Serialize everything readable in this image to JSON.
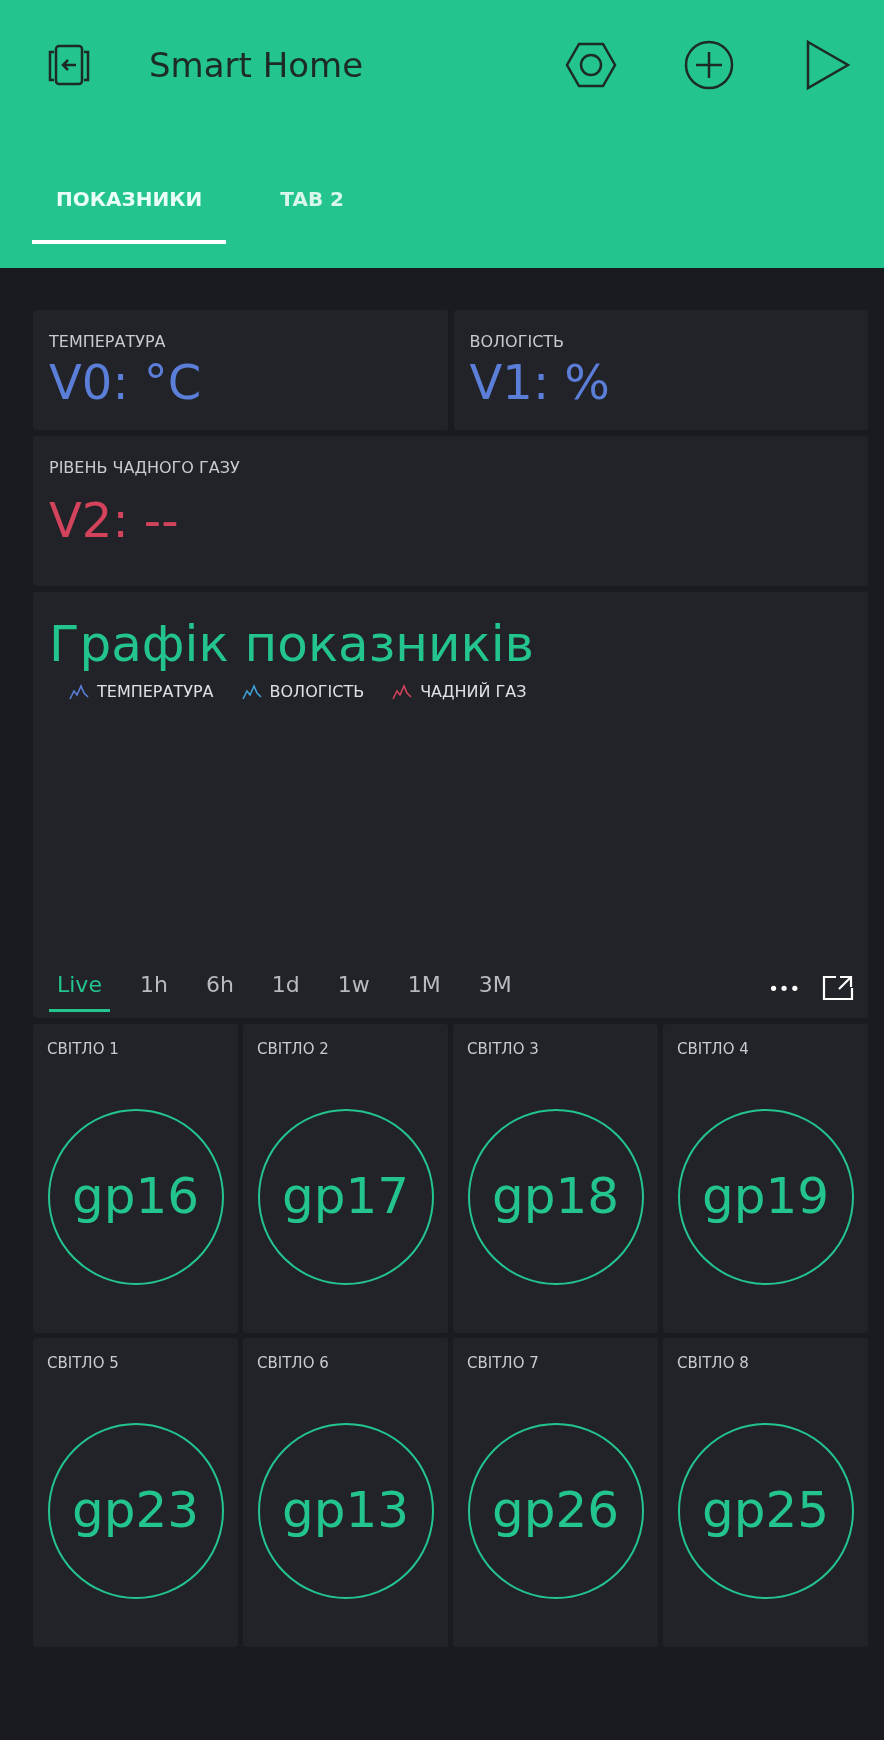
{
  "header": {
    "title": "Smart Home"
  },
  "tabs": [
    {
      "label": "ПОКАЗНИКИ",
      "selected": true
    },
    {
      "label": "TAB 2",
      "selected": false
    }
  ],
  "displays": [
    {
      "label": "ТЕМПЕРАТУРА",
      "value": "V0: °C",
      "color": "#5b7fd9",
      "wide": false
    },
    {
      "label": "ВОЛОГІСТЬ",
      "value": "V1: %",
      "color": "#5b7fd9",
      "wide": false
    },
    {
      "label": "РІВЕНЬ ЧАДНОГО ГАЗУ",
      "value": "V2: --",
      "color": "#d3435c",
      "wide": true
    }
  ],
  "chart": {
    "title": "Графік показників",
    "legend": [
      {
        "label": "ТЕМПЕРАТУРА",
        "color": "#5b7fd9"
      },
      {
        "label": "ВОЛОГІСТЬ",
        "color": "#3f9fd6"
      },
      {
        "label": "ЧАДНИЙ ГАЗ",
        "color": "#d3435c"
      }
    ],
    "periods": [
      {
        "label": "Live",
        "selected": true
      },
      {
        "label": "1h",
        "selected": false
      },
      {
        "label": "6h",
        "selected": false
      },
      {
        "label": "1d",
        "selected": false
      },
      {
        "label": "1w",
        "selected": false
      },
      {
        "label": "1M",
        "selected": false
      },
      {
        "label": "3M",
        "selected": false
      }
    ],
    "more": "•••"
  },
  "buttons": [
    {
      "label": "СВІТЛО 1",
      "pin": "gp16"
    },
    {
      "label": "СВІТЛО 2",
      "pin": "gp17"
    },
    {
      "label": "СВІТЛО 3",
      "pin": "gp18"
    },
    {
      "label": "СВІТЛО 4",
      "pin": "gp19"
    },
    {
      "label": "СВІТЛО 5",
      "pin": "gp23"
    },
    {
      "label": "СВІТЛО 6",
      "pin": "gp13"
    },
    {
      "label": "СВІТЛО 7",
      "pin": "gp26"
    },
    {
      "label": "СВІТЛО 8",
      "pin": "gp25"
    }
  ]
}
